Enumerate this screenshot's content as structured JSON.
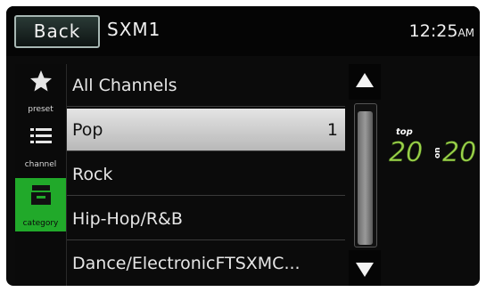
{
  "header": {
    "back_label": "Back",
    "title": "SXM1",
    "clock_time": "12:25",
    "clock_ampm": "AM"
  },
  "sidebar": {
    "items": [
      {
        "label": "preset",
        "icon": "star-icon",
        "active": false
      },
      {
        "label": "channel",
        "icon": "list-icon",
        "active": false
      },
      {
        "label": "category",
        "icon": "category-tray-icon",
        "active": true
      }
    ]
  },
  "list": {
    "items": [
      {
        "label": "All Channels",
        "number": ""
      },
      {
        "label": "Pop",
        "number": "1"
      },
      {
        "label": "Rock",
        "number": ""
      },
      {
        "label": "Hip-Hop/R&B",
        "number": ""
      },
      {
        "label": "Dance/ElectronicFTSXMC...",
        "number": ""
      }
    ],
    "selected_index": 1
  },
  "scroll": {
    "up_icon": "triangle-up-icon",
    "down_icon": "triangle-down-icon"
  },
  "logo": {
    "top_text": "top",
    "left_number": "20",
    "mid_text": "on",
    "right_number": "20"
  },
  "colors": {
    "accent_green": "#21a92a",
    "logo_green": "#9bd24a"
  }
}
